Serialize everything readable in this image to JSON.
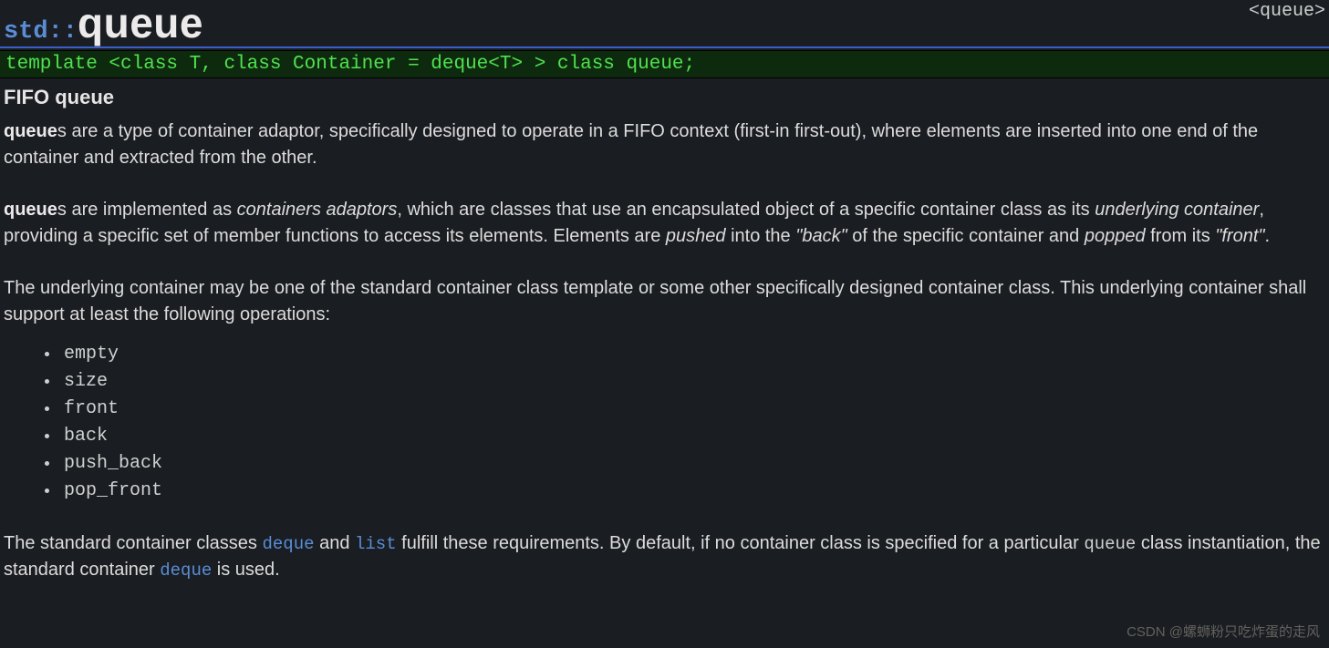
{
  "header": {
    "namespace": "std::",
    "class": "queue",
    "include": "<queue>"
  },
  "declaration": "template <class T, class Container = deque<T> > class queue;",
  "subheading": "FIFO queue",
  "para1": {
    "kw": "queue",
    "rest": "s are a type of container adaptor, specifically designed to operate in a FIFO context (first-in first-out), where elements are inserted into one end of the container and extracted from the other."
  },
  "para2": {
    "kw": "queue",
    "seg1": "s are implemented as ",
    "em1": "containers adaptors",
    "seg2": ", which are classes that use an encapsulated object of a specific container class as its ",
    "em2": "underlying container",
    "seg3": ", providing a specific set of member functions to access its elements. Elements are ",
    "em3": "pushed",
    "seg4": " into the ",
    "em4": "\"back\"",
    "seg5": " of the specific container and ",
    "em5": "popped",
    "seg6": " from its ",
    "em6": "\"front\"",
    "seg7": "."
  },
  "para3": "The underlying container may be one of the standard container class template or some other specifically designed container class. This underlying container shall support at least the following operations:",
  "operations": [
    "empty",
    "size",
    "front",
    "back",
    "push_back",
    "pop_front"
  ],
  "para4": {
    "seg1": "The standard container classes ",
    "link1": "deque",
    "seg2": " and ",
    "link2": "list",
    "seg3": " fulfill these requirements. By default, if no container class is specified for a particular ",
    "mono": "queue",
    "seg4": " class instantiation, the standard container ",
    "link3": "deque",
    "seg5": " is used."
  },
  "watermark": "CSDN @螺蛳粉只吃炸蛋的走风"
}
